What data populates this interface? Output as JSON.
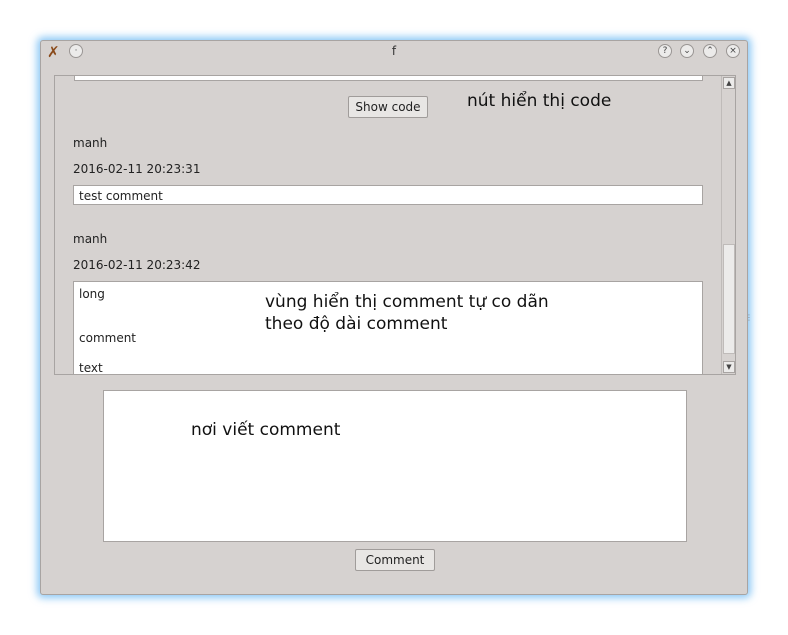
{
  "window": {
    "title": "f"
  },
  "titlebar_buttons": {
    "help": "?",
    "minimize": "⌄",
    "maximize": "⌃",
    "close": "×",
    "menu": "·"
  },
  "thread": {
    "show_code_label": "Show code",
    "comments": [
      {
        "author": "manh",
        "timestamp": "2016-02-11 20:23:31",
        "lines": [
          "test comment"
        ]
      },
      {
        "author": "manh",
        "timestamp": "2016-02-11 20:23:42",
        "lines": [
          "long",
          "comment",
          "text"
        ]
      }
    ]
  },
  "composer": {
    "value": "",
    "submit_label": "Comment"
  },
  "annotations": {
    "show_code": "nút hiển thị code",
    "comment_area_line1": "vùng hiển thị comment tự co dãn",
    "comment_area_line2": "theo độ dài comment",
    "write_area": "nơi viết comment"
  }
}
